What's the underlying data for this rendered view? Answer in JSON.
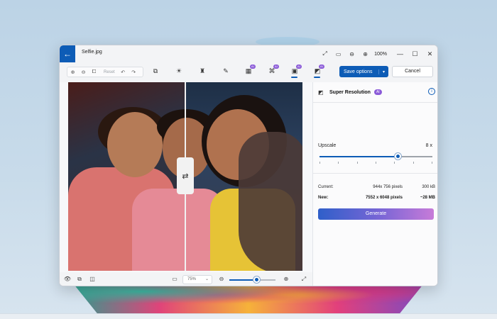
{
  "window": {
    "file_name": "Selfie.jpg",
    "zoom_percent": "100%"
  },
  "toolbar": {
    "reset_label": "Reset",
    "ai_badge": "AI",
    "save_label": "Save options",
    "cancel_label": "Cancel"
  },
  "canvas": {
    "zoom_select_value": "75%",
    "zoom_slider_level": 0.6
  },
  "panel": {
    "title": "Super Resolution",
    "ai_badge": "AI",
    "info_icon": "i",
    "upscale_label": "Upscale",
    "upscale_value": "8 x",
    "upscale_level": 0.7,
    "current_label": "Current:",
    "current_pixels": "944x 756 pixels",
    "current_size": "300 kB",
    "new_label": "New:",
    "new_pixels": "7552 x 6048 pixels",
    "new_size": "~28 MB",
    "generate_label": "Generate"
  },
  "colors": {
    "accent": "#0d5cb6",
    "ai_badge": "#8b5bd8"
  }
}
